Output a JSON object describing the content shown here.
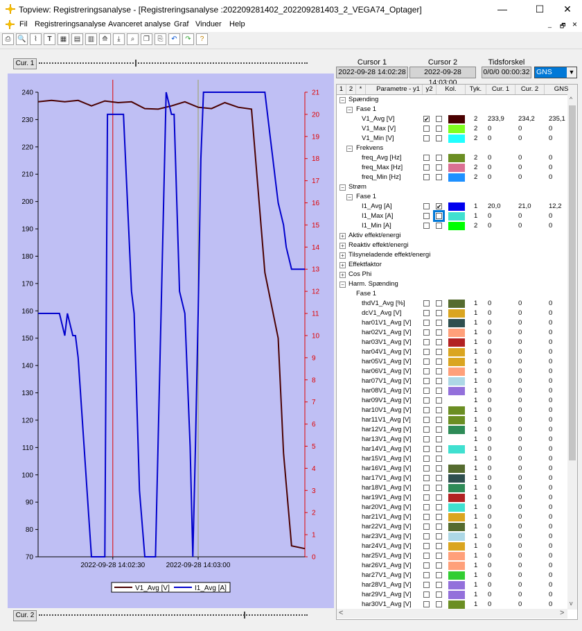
{
  "window": {
    "title": "Topview: Registreringsanalyse - [Registreringsanalyse :202209281402_202209281403_2_VEGA74_Optager]",
    "minimize": "—",
    "maximize": "☐",
    "close": "✕"
  },
  "menu": {
    "items": [
      "Fil",
      "Registreringsanalyse",
      "Avanceret analyse",
      "Graf",
      "Vinduer",
      "Help"
    ]
  },
  "mdi_controls": [
    "_",
    "🗗",
    "×"
  ],
  "cursors": {
    "cur1_label": "Cur. 1",
    "cur2_label": "Cur. 2",
    "cursor1_title": "Cursor 1",
    "cursor2_title": "Cursor 2",
    "diff_title": "Tidsforskel",
    "cursor1_value": "2022-09-28 14:02:28",
    "cursor2_value": "2022-09-28 14:03:00",
    "diff_value": "0/0/0 00:00:32",
    "gns_value": "GNS"
  },
  "grid_header": [
    "1",
    "2",
    "*",
    "Parametre - y1",
    "y2",
    "Kol.",
    "Tyk.",
    "Cur. 1",
    "Cur. 2",
    "GNS"
  ],
  "grid_rows": [
    {
      "level": 0,
      "exp": "minus",
      "text": "Spænding"
    },
    {
      "level": 1,
      "exp": "minus",
      "text": "Fase 1"
    },
    {
      "level": 2,
      "text": "V1_Avg [V]",
      "y1": "✔",
      "y2": "",
      "color": "#4a0000",
      "tyk": "2",
      "c1": "233,9",
      "c2": "234,2",
      "gns": "235,1"
    },
    {
      "level": 2,
      "text": "V1_Max [V]",
      "y1": "",
      "y2": "",
      "color": "#80ff20",
      "tyk": "2",
      "c1": "0",
      "c2": "0",
      "gns": "0"
    },
    {
      "level": 2,
      "text": "V1_Min [V]",
      "y1": "",
      "y2": "",
      "color": "#20ffff",
      "tyk": "2",
      "c1": "0",
      "c2": "0",
      "gns": "0"
    },
    {
      "level": 1,
      "exp": "minus",
      "text": "Frekvens"
    },
    {
      "level": 2,
      "text": "freq_Avg [Hz]",
      "y1": "",
      "y2": "",
      "color": "#6b8e23",
      "tyk": "2",
      "c1": "0",
      "c2": "0",
      "gns": "0"
    },
    {
      "level": 2,
      "text": "freq_Max [Hz]",
      "y1": "",
      "y2": "",
      "color": "#db7093",
      "tyk": "2",
      "c1": "0",
      "c2": "0",
      "gns": "0"
    },
    {
      "level": 2,
      "text": "freq_Min [Hz]",
      "y1": "",
      "y2": "",
      "color": "#1e90ff",
      "tyk": "2",
      "c1": "0",
      "c2": "0",
      "gns": "0"
    },
    {
      "level": 0,
      "exp": "minus",
      "text": "Strøm"
    },
    {
      "level": 1,
      "exp": "minus",
      "text": "Fase 1"
    },
    {
      "level": 2,
      "text": "I1_Avg [A]",
      "y1": "",
      "y2": "✔",
      "color": "#0000ee",
      "tyk": "1",
      "c1": "20,0",
      "c2": "21,0",
      "gns": "12,2"
    },
    {
      "level": 2,
      "text": "I1_Max [A]",
      "y1": "",
      "y2": "sel",
      "color": "#40e0d0",
      "tyk": "1",
      "c1": "0",
      "c2": "0",
      "gns": "0"
    },
    {
      "level": 2,
      "text": "I1_Min [A]",
      "y1": "",
      "y2": "",
      "color": "#00ff00",
      "tyk": "2",
      "c1": "0",
      "c2": "0",
      "gns": "0"
    },
    {
      "level": 0,
      "exp": "plus",
      "text": "Aktiv effekt/energi"
    },
    {
      "level": 0,
      "exp": "plus",
      "text": "Reaktiv effekt/energi"
    },
    {
      "level": 0,
      "exp": "plus",
      "text": "Tilsyneladende effekt/energi"
    },
    {
      "level": 0,
      "exp": "plus",
      "text": "Effektfaktor"
    },
    {
      "level": 0,
      "exp": "plus",
      "text": "Cos Phi"
    },
    {
      "level": 0,
      "exp": "minus",
      "text": "Harm. Spænding"
    },
    {
      "level": 1,
      "exp": "none",
      "text": "Fase 1"
    },
    {
      "level": 2,
      "text": "thdV1_Avg [%]",
      "color": "#556b2f",
      "tyk": "1",
      "c1": "0",
      "c2": "0",
      "gns": "0"
    },
    {
      "level": 2,
      "text": "dcV1_Avg [V]",
      "color": "#daa520",
      "tyk": "1",
      "c1": "0",
      "c2": "0",
      "gns": "0"
    },
    {
      "level": 2,
      "text": "har01V1_Avg [V]",
      "color": "#2f4f4f",
      "tyk": "1",
      "c1": "0",
      "c2": "0",
      "gns": "0"
    },
    {
      "level": 2,
      "text": "har02V1_Avg [V]",
      "color": "#ffa07a",
      "tyk": "1",
      "c1": "0",
      "c2": "0",
      "gns": "0"
    },
    {
      "level": 2,
      "text": "har03V1_Avg [V]",
      "color": "#b22222",
      "tyk": "1",
      "c1": "0",
      "c2": "0",
      "gns": "0"
    },
    {
      "level": 2,
      "text": "har04V1_Avg [V]",
      "color": "#daa520",
      "tyk": "1",
      "c1": "0",
      "c2": "0",
      "gns": "0"
    },
    {
      "level": 2,
      "text": "har05V1_Avg [V]",
      "color": "#daa520",
      "tyk": "1",
      "c1": "0",
      "c2": "0",
      "gns": "0"
    },
    {
      "level": 2,
      "text": "har06V1_Avg [V]",
      "color": "#ffa07a",
      "tyk": "1",
      "c1": "0",
      "c2": "0",
      "gns": "0"
    },
    {
      "level": 2,
      "text": "har07V1_Avg [V]",
      "color": "#add8e6",
      "tyk": "1",
      "c1": "0",
      "c2": "0",
      "gns": "0"
    },
    {
      "level": 2,
      "text": "har08V1_Avg [V]",
      "color": "#9370db",
      "tyk": "1",
      "c1": "0",
      "c2": "0",
      "gns": "0"
    },
    {
      "level": 2,
      "text": "har09V1_Avg [V]",
      "color": "",
      "tyk": "1",
      "c1": "0",
      "c2": "0",
      "gns": "0"
    },
    {
      "level": 2,
      "text": "har10V1_Avg [V]",
      "color": "#6b8e23",
      "tyk": "1",
      "c1": "0",
      "c2": "0",
      "gns": "0"
    },
    {
      "level": 2,
      "text": "har11V1_Avg [V]",
      "color": "#6b8e23",
      "tyk": "1",
      "c1": "0",
      "c2": "0",
      "gns": "0"
    },
    {
      "level": 2,
      "text": "har12V1_Avg [V]",
      "color": "#2e8b57",
      "tyk": "1",
      "c1": "0",
      "c2": "0",
      "gns": "0"
    },
    {
      "level": 2,
      "text": "har13V1_Avg [V]",
      "color": "",
      "tyk": "1",
      "c1": "0",
      "c2": "0",
      "gns": "0"
    },
    {
      "level": 2,
      "text": "har14V1_Avg [V]",
      "color": "#40e0d0",
      "tyk": "1",
      "c1": "0",
      "c2": "0",
      "gns": "0"
    },
    {
      "level": 2,
      "text": "har15V1_Avg [V]",
      "color": "",
      "tyk": "1",
      "c1": "0",
      "c2": "0",
      "gns": "0"
    },
    {
      "level": 2,
      "text": "har16V1_Avg [V]",
      "color": "#556b2f",
      "tyk": "1",
      "c1": "0",
      "c2": "0",
      "gns": "0"
    },
    {
      "level": 2,
      "text": "har17V1_Avg [V]",
      "color": "#2f4f4f",
      "tyk": "1",
      "c1": "0",
      "c2": "0",
      "gns": "0"
    },
    {
      "level": 2,
      "text": "har18V1_Avg [V]",
      "color": "#2e8b57",
      "tyk": "1",
      "c1": "0",
      "c2": "0",
      "gns": "0"
    },
    {
      "level": 2,
      "text": "har19V1_Avg [V]",
      "color": "#b22222",
      "tyk": "1",
      "c1": "0",
      "c2": "0",
      "gns": "0"
    },
    {
      "level": 2,
      "text": "har20V1_Avg [V]",
      "color": "#40e0d0",
      "tyk": "1",
      "c1": "0",
      "c2": "0",
      "gns": "0"
    },
    {
      "level": 2,
      "text": "har21V1_Avg [V]",
      "color": "#daa520",
      "tyk": "1",
      "c1": "0",
      "c2": "0",
      "gns": "0"
    },
    {
      "level": 2,
      "text": "har22V1_Avg [V]",
      "color": "#556b2f",
      "tyk": "1",
      "c1": "0",
      "c2": "0",
      "gns": "0"
    },
    {
      "level": 2,
      "text": "har23V1_Avg [V]",
      "color": "#add8e6",
      "tyk": "1",
      "c1": "0",
      "c2": "0",
      "gns": "0"
    },
    {
      "level": 2,
      "text": "har24V1_Avg [V]",
      "color": "#daa520",
      "tyk": "1",
      "c1": "0",
      "c2": "0",
      "gns": "0"
    },
    {
      "level": 2,
      "text": "har25V1_Avg [V]",
      "color": "#ffa07a",
      "tyk": "1",
      "c1": "0",
      "c2": "0",
      "gns": "0"
    },
    {
      "level": 2,
      "text": "har26V1_Avg [V]",
      "color": "#ffa07a",
      "tyk": "1",
      "c1": "0",
      "c2": "0",
      "gns": "0"
    },
    {
      "level": 2,
      "text": "har27V1_Avg [V]",
      "color": "#32cd32",
      "tyk": "1",
      "c1": "0",
      "c2": "0",
      "gns": "0"
    },
    {
      "level": 2,
      "text": "har28V1_Avg [V]",
      "color": "#9370db",
      "tyk": "1",
      "c1": "0",
      "c2": "0",
      "gns": "0"
    },
    {
      "level": 2,
      "text": "har29V1_Avg [V]",
      "color": "#9370db",
      "tyk": "1",
      "c1": "0",
      "c2": "0",
      "gns": "0"
    },
    {
      "level": 2,
      "text": "har30V1_Avg [V]",
      "color": "#6b8e23",
      "tyk": "1",
      "c1": "0",
      "c2": "0",
      "gns": "0"
    }
  ],
  "chart_data": {
    "type": "line",
    "title": "",
    "x_ticks": [
      "2022-09-28 14:02:30",
      "2022-09-28 14:03:00"
    ],
    "y1_lim": [
      70,
      240
    ],
    "y1_ticks": [
      240,
      230,
      220,
      210,
      200,
      190,
      180,
      170,
      160,
      150,
      140,
      130,
      120,
      110,
      100,
      90,
      80,
      70
    ],
    "y2_lim": [
      0,
      21
    ],
    "y2_ticks": [
      21,
      20,
      19,
      18,
      17,
      16,
      15,
      14,
      13,
      12,
      11,
      10,
      9,
      8,
      7,
      6,
      5,
      4,
      3,
      2,
      1,
      0
    ],
    "cursor_x": [
      28,
      60
    ],
    "legend_placement": "bottom-center",
    "grid": false,
    "series": [
      {
        "name": "V1_Avg [V]",
        "axis": "y1",
        "color": "#4a0000",
        "x": [
          0,
          5,
          10,
          15,
          20,
          25,
          30,
          35,
          40,
          45,
          50,
          55,
          60,
          65,
          70,
          75,
          80,
          85,
          90,
          92,
          95,
          100
        ],
        "y": [
          236.5,
          237,
          236.5,
          237,
          235,
          236.8,
          236.2,
          236.5,
          234,
          233.8,
          235,
          236.5,
          234.5,
          234,
          236.2,
          234.5,
          233.8,
          174,
          150,
          108,
          74,
          73
        ]
      },
      {
        "name": "I1_Avg [A]",
        "axis": "y2",
        "color": "#0000cc",
        "x": [
          0,
          5,
          7,
          8,
          10,
          11,
          13,
          14,
          15,
          20,
          21,
          23,
          25,
          26,
          28,
          30,
          32,
          35,
          36,
          38,
          40,
          42,
          44,
          48,
          50,
          51,
          53,
          55,
          57,
          58,
          59,
          60,
          61,
          62,
          63,
          64,
          66,
          67,
          68,
          70,
          72,
          73,
          75,
          78,
          80,
          82,
          85,
          86,
          87,
          88,
          89,
          90,
          92,
          93,
          95,
          97,
          100
        ],
        "y": [
          11,
          11,
          11,
          11,
          10,
          11,
          10,
          10,
          9,
          0,
          0,
          0,
          0,
          20,
          20,
          20,
          20,
          12,
          11,
          3,
          0,
          0,
          0,
          21,
          20,
          20,
          12,
          11,
          5,
          0,
          5,
          11,
          18,
          21,
          21,
          21,
          21,
          21,
          21,
          21,
          21,
          21,
          21,
          21,
          21,
          21,
          21,
          20,
          19,
          18,
          17,
          16,
          15,
          14,
          13,
          13,
          13
        ]
      }
    ]
  }
}
